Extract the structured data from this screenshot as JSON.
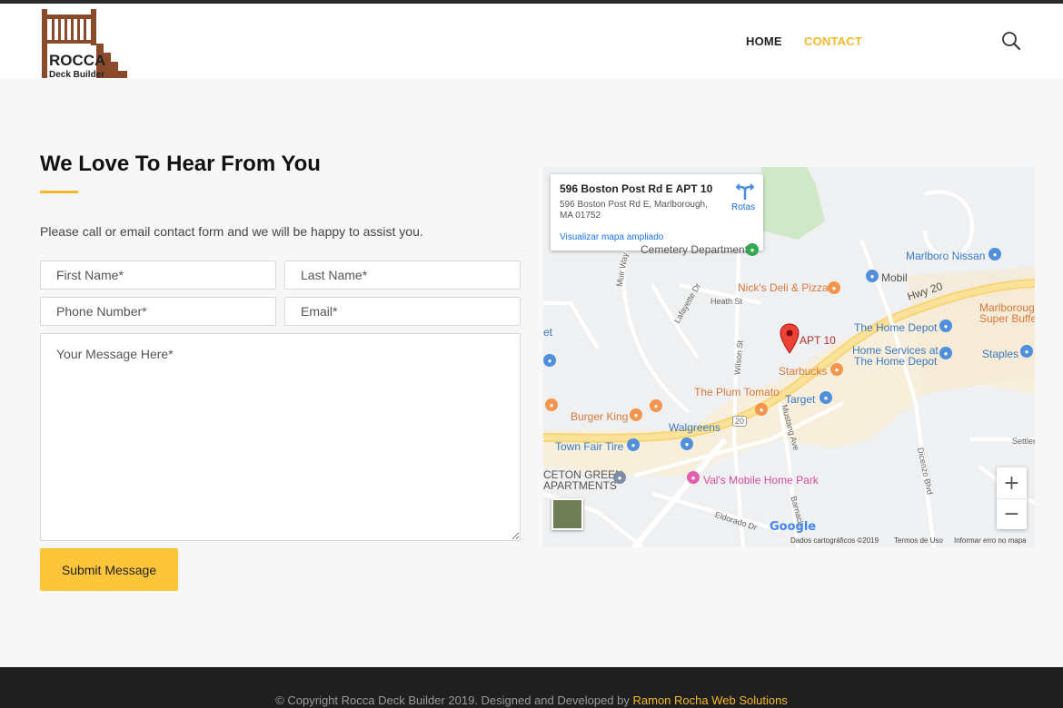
{
  "logo": {
    "name": "ROCCA",
    "tagline": "Deck Builder",
    "icon": "deck-railing-icon"
  },
  "nav": {
    "home": "HOME",
    "contact": "CONTACT"
  },
  "colors": {
    "accent": "#f4b92b",
    "button": "#fdc53a",
    "footer": "#1f1f1f"
  },
  "contact": {
    "heading": "We Love To Hear From You",
    "intro": "Please call or email contact form and we will be happy to assist you.",
    "first_name_placeholder": "First Name*",
    "last_name_placeholder": "Last Name*",
    "phone_placeholder": "Phone Number*",
    "email_placeholder": "Email*",
    "message_placeholder": "Your Message Here*",
    "submit_label": "Submit Message"
  },
  "map": {
    "info_title": "596 Boston Post Rd E APT 10",
    "info_address": "596 Boston Post Rd E, Marlborough, MA 01752",
    "info_link": "Visualizar mapa ampliado",
    "directions": "Rotas",
    "marker_label": "APT 10",
    "labels": {
      "cemetery": "Cemetery Department",
      "nicks": "Nick's Deli & Pizza",
      "mobil": "Mobil",
      "marlboro_nissan": "Marlboro Nissan",
      "hwy20": "Hwy 20",
      "marlborough_1": "Marlboroug",
      "marlborough_2": "Super Buffe",
      "home_depot": "The Home Depot",
      "home_services_1": "Home Services at",
      "home_services_2": "The Home Depot",
      "staples": "Staples",
      "starbucks": "Starbucks",
      "plum_tomato": "The Plum Tomato",
      "target": "Target",
      "burger_king": "Burger King",
      "walgreens": "Walgreens",
      "town_fair": "Town Fair Tire",
      "ceton_1": "CETON GREEN",
      "ceton_2": "APARTMENTS",
      "vals": "Val's Mobile Home Park",
      "heath_st": "Heath St",
      "lafayette": "Lafayette Dr",
      "muir": "Muir Way",
      "wilson": "Wilson St",
      "mustang": "Mustang Ave",
      "eldorado": "Eldorado Dr",
      "barnacle": "Barnacle",
      "dicenzo": "Dicenzo Blvd",
      "settler": "Settler",
      "route": "20",
      "et": "et"
    },
    "zoom_in": "+",
    "zoom_out": "−",
    "google": "Google",
    "footer_data": "Dados cartográficos ©2019",
    "footer_terms": "Termos de Uso",
    "footer_report": "Informar erro no mapa"
  },
  "footer": {
    "copyright": "© Copyright Rocca Deck Builder 2019. Designed and Developed by ",
    "credit": "Ramon Rocha Web Solutions"
  }
}
